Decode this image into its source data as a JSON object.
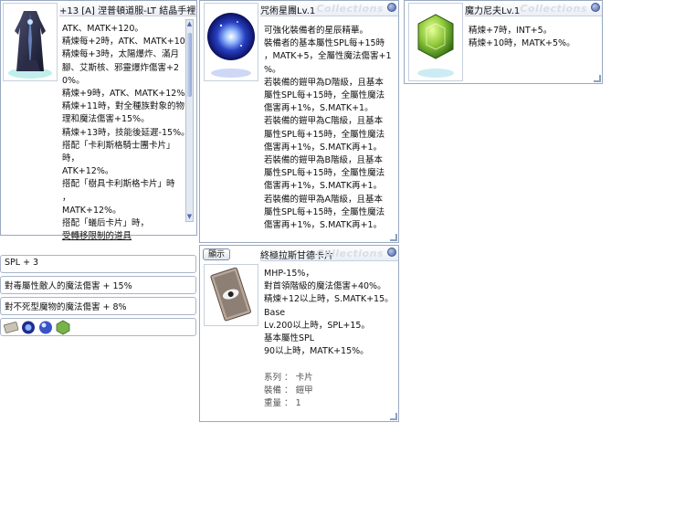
{
  "watermark": "Collections",
  "item_window": {
    "title": "+13 [A] 涅普頓道服-LT 結晶手裡",
    "lines": [
      "ATK、MATK+120。",
      "精煉每+2時，ATK、MATK+10。",
      "精煉每+3時，太陽爆炸、滿月",
      "腳、艾斯核、邪靈爆炸傷害+2",
      "0%。",
      "精煉+9時，ATK、MATK+12%。",
      "精煉+11時，對全種族對象的物",
      "理和魔法傷害+15%。",
      "精煉+13時，技能後延遲-15%。",
      "搭配「卡利斯格騎士團卡片」",
      "時，",
      "ATK+12%。",
      "搭配「樹具卡利斯格卡片」時",
      "，",
      "MATK+12%。",
      "搭配「蟻后卡片」時，",
      "受轉移限制的道具"
    ]
  },
  "stats": [
    "SPL + 3",
    "對毒屬性敵人的魔法傷害 + 15%",
    "對不死型魔物的魔法傷害 + 8%"
  ],
  "star_window": {
    "title": "咒術星團Lv.1",
    "lines": [
      "可強化裝備者的星辰精華。",
      "裝備者的基本屬性SPL每+15時",
      "，MATK+5，全屬性魔法傷害+1",
      "%。",
      "若裝備的鎧甲為D階級，且基本",
      "屬性SPL每+15時，全屬性魔法",
      "傷害再+1%，S.MATK+1。",
      "若裝備的鎧甲為C階級，且基本",
      "屬性SPL每+15時，全屬性魔法",
      "傷害再+1%，S.MATK再+1。",
      "若裝備的鎧甲為B階級，且基本",
      "屬性SPL每+15時，全屬性魔法",
      "傷害再+1%，S.MATK再+1。",
      "若裝備的鎧甲為A階級，且基本",
      "屬性SPL每+15時，全屬性魔法",
      "傷害再+1%，S.MATK再+1。"
    ]
  },
  "magic_window": {
    "title": "魔力尼夫Lv.1",
    "lines": [
      "精煉+7時，INT+5。",
      "精煉+10時，MATK+5%。"
    ]
  },
  "card_window": {
    "show_button": "顯示",
    "title": "終極拉斯甘德卡片",
    "lines": [
      "MHP-15%，",
      "對首領階級的魔法傷害+40%。",
      "精煉+12以上時，S.MATK+15。",
      "Base",
      "Lv.200以上時，SPL+15。",
      "基本屬性SPL",
      "90以上時，MATK+15%。"
    ],
    "props": [
      {
        "label": "系列",
        "sep": "：",
        "value": "卡片"
      },
      {
        "label": "裝備",
        "sep": "：",
        "value": "鎧甲"
      },
      {
        "label": "重量",
        "sep": "：",
        "value": "1"
      }
    ]
  }
}
